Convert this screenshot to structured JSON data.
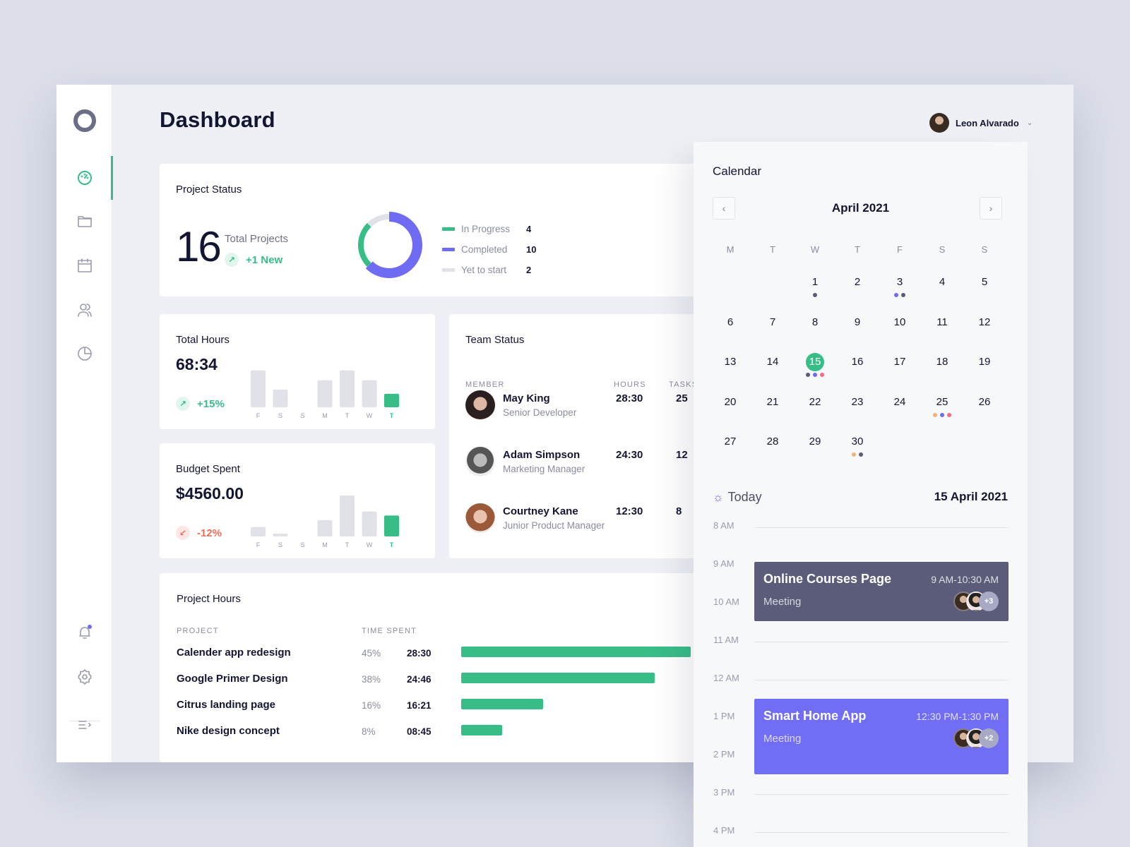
{
  "header": {
    "title": "Dashboard",
    "user_name": "Leon Alvarado"
  },
  "sidebar": {
    "items": [
      {
        "name": "dashboard",
        "icon": "gauge-icon",
        "active": true
      },
      {
        "name": "projects",
        "icon": "folder-icon",
        "active": false
      },
      {
        "name": "calendar",
        "icon": "calendar-icon",
        "active": false
      },
      {
        "name": "team",
        "icon": "users-icon",
        "active": false
      },
      {
        "name": "reports",
        "icon": "pie-chart-icon",
        "active": false
      }
    ],
    "bottom": [
      {
        "name": "notifications",
        "icon": "bell-icon",
        "has_badge": true
      },
      {
        "name": "settings",
        "icon": "gear-icon"
      },
      {
        "name": "collapse",
        "icon": "menu-collapse-icon"
      }
    ]
  },
  "colors": {
    "green": "#38bd87",
    "purple": "#6f6bf3",
    "gray": "#e1e2e7",
    "slate": "#5b5c7a",
    "red": "#f26b57",
    "orange": "#f3b27a",
    "pink": "#f36b85"
  },
  "project_status": {
    "title": "Project Status",
    "total": "16",
    "total_label": "Total Projects",
    "new_label": "+1 New",
    "legend": [
      {
        "label": "In Progress",
        "value": 4,
        "color": "#38bd87"
      },
      {
        "label": "Completed",
        "value": 10,
        "color": "#6f6bf3"
      },
      {
        "label": "Yet to start",
        "value": 2,
        "color": "#e1e2e7"
      }
    ]
  },
  "total_hours": {
    "title": "Total Hours",
    "value": "68:34",
    "change": "+15%",
    "days": [
      "F",
      "S",
      "S",
      "M",
      "T",
      "W",
      "T"
    ],
    "bars": [
      0.9,
      0.43,
      0,
      0.66,
      0.9,
      0.66,
      0.33
    ]
  },
  "budget_spent": {
    "title": "Budget Spent",
    "value": "$4560.00",
    "change": "-12%",
    "days": [
      "F",
      "S",
      "S",
      "M",
      "T",
      "W",
      "T"
    ],
    "bars": [
      0.23,
      0.07,
      0,
      0.4,
      1.0,
      0.61,
      0.51
    ]
  },
  "team_status": {
    "title": "Team Status",
    "columns": {
      "member": "MEMBER",
      "hours": "HOURS",
      "tasks": "TASKS"
    },
    "rows": [
      {
        "name": "May King",
        "role": "Senior Developer",
        "hours": "28:30",
        "tasks": "25"
      },
      {
        "name": "Adam Simpson",
        "role": "Marketing Manager",
        "hours": "24:30",
        "tasks": "12"
      },
      {
        "name": "Courtney Kane",
        "role": "Junior Product Manager",
        "hours": "12:30",
        "tasks": "8"
      }
    ]
  },
  "project_hours": {
    "title": "Project Hours",
    "columns": {
      "project": "PROJECT",
      "time": "TIME SPENT"
    },
    "rows": [
      {
        "name": "Calender app redesign",
        "percent": "45%",
        "time": "28:30",
        "share": 0.45
      },
      {
        "name": "Google Primer Design",
        "percent": "38%",
        "time": "24:46",
        "share": 0.38
      },
      {
        "name": "Citrus landing page",
        "percent": "16%",
        "time": "16:21",
        "share": 0.16
      },
      {
        "name": "Nike design concept",
        "percent": "8%",
        "time": "08:45",
        "share": 0.08
      }
    ]
  },
  "calendar": {
    "title": "Calendar",
    "month": "April 2021",
    "weekdays": [
      "M",
      "T",
      "W",
      "T",
      "F",
      "S",
      "S"
    ],
    "first_weekday_index": 2,
    "days_in_month": 30,
    "today": 15,
    "event_dots": {
      "1": [
        "#5b5c7a"
      ],
      "3": [
        "#6f6bf3",
        "#5b5c7a"
      ],
      "15": [
        "#5b5c7a",
        "#6f6bf3",
        "#f36b85"
      ],
      "25": [
        "#f3b27a",
        "#6f6bf3",
        "#f36b85"
      ],
      "30": [
        "#f3b27a",
        "#5b5c7a"
      ]
    },
    "today_label": "Today",
    "today_date": "15 April 2021",
    "hours": [
      "8 AM",
      "9 AM",
      "10 AM",
      "11 AM",
      "12 AM",
      "1 PM",
      "2 PM",
      "3 PM",
      "4 PM"
    ],
    "events": [
      {
        "title": "Online Courses Page",
        "subtitle": "Meeting",
        "time": "9 AM-10:30 AM",
        "extra": "+3",
        "color": "#5b5c7a"
      },
      {
        "title": "Smart Home App",
        "subtitle": "Meeting",
        "time": "12:30 PM-1:30 PM",
        "extra": "+2",
        "color": "#716df5"
      }
    ]
  }
}
